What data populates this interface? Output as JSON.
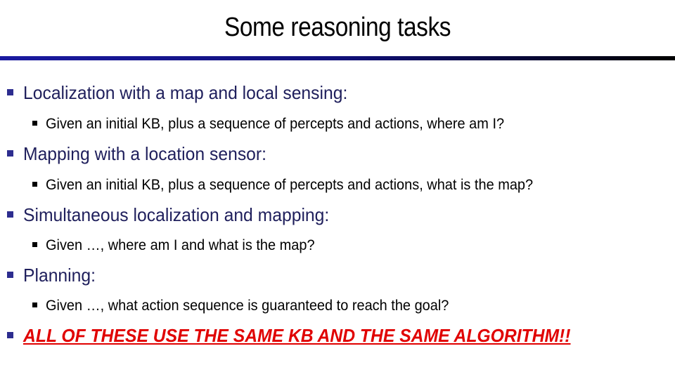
{
  "slide": {
    "title": "Some reasoning tasks",
    "bullets": [
      {
        "text": "Localization with a map and local sensing:",
        "sub": "Given an initial KB, plus a sequence of percepts and actions, where am I?"
      },
      {
        "text": "Mapping with a location sensor:",
        "sub": "Given an initial KB, plus a sequence of percepts and actions, what is the map?"
      },
      {
        "text": "Simultaneous localization and mapping:",
        "sub": "Given …, where am I and what is the map?"
      },
      {
        "text": "Planning:",
        "sub": "Given …, what action sequence is guaranteed to reach the goal?"
      },
      {
        "text": "ALL OF THESE USE THE SAME KB AND THE SAME ALGORITHM!!"
      }
    ],
    "colors": {
      "bullet_text": "#1f1f5c",
      "emphasis": "#e00000",
      "rule_start": "#1a1aa0",
      "rule_end": "#000000"
    }
  }
}
